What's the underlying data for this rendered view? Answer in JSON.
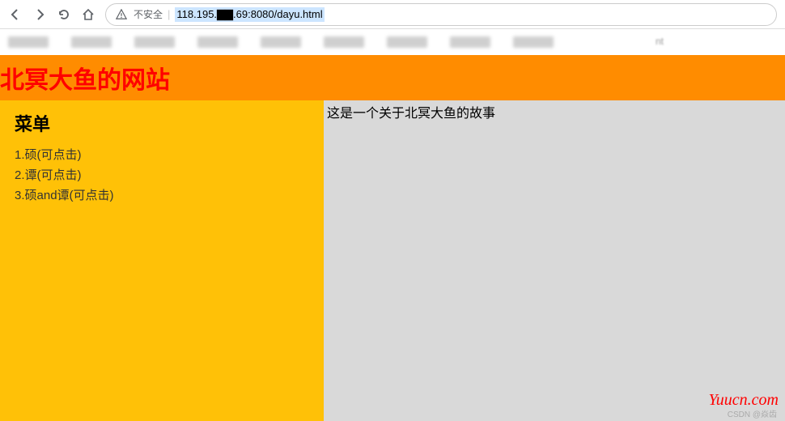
{
  "browser": {
    "insecure_label": "不安全",
    "url": "118.195.▇▇.69:8080/dayu.html"
  },
  "bookmarks": {
    "partial_text": "nt"
  },
  "header": {
    "title": "北冥大鱼的网站"
  },
  "sidebar": {
    "heading": "菜单",
    "items": [
      "1.硕(可点击)",
      "2.谭(可点击)",
      "3.硕and谭(可点击)"
    ]
  },
  "content": {
    "text": "这是一个关于北冥大鱼的故事"
  },
  "watermark": "Yuucn.com",
  "csdn": "CSDN @焱齿"
}
